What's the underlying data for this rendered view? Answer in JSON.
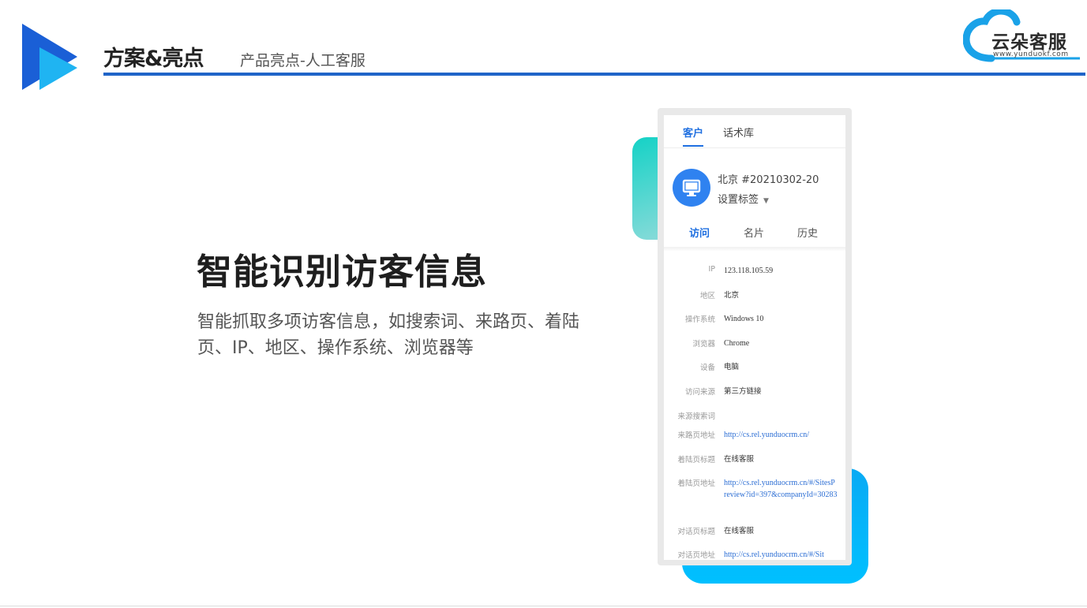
{
  "header": {
    "title": "方案&亮点",
    "subtitle": "产品亮点-人工客服",
    "brand_name": "云朵客服",
    "brand_url": "www.yunduokf.com"
  },
  "main": {
    "headline": "智能识别访客信息",
    "description": "智能抓取多项访客信息，如搜索词、来路页、着陆页、IP、地区、操作系统、浏览器等"
  },
  "panel": {
    "top_tabs": [
      {
        "label": "客户",
        "active": true
      },
      {
        "label": "话术库",
        "active": false
      }
    ],
    "visitor_name": "北京 #20210302-20",
    "tag_setting": "设置标签",
    "sub_tabs": [
      {
        "label": "访问",
        "active": true
      },
      {
        "label": "名片",
        "active": false
      },
      {
        "label": "历史",
        "active": false
      }
    ],
    "rows": [
      {
        "label": "IP",
        "value": "123.118.105.59"
      },
      {
        "label": "地区",
        "value": "北京"
      },
      {
        "label": "操作系统",
        "value": "Windows 10"
      },
      {
        "label": "浏览器",
        "value": "Chrome"
      },
      {
        "label": "设备",
        "value": "电脑"
      },
      {
        "label": "访问来源",
        "value": "第三方链接"
      },
      {
        "label": "来源搜索词",
        "value": ""
      },
      {
        "label": "来路页地址",
        "value": "http://cs.rel.yunduocrm.cn/"
      },
      {
        "label": "着陆页标题",
        "value": "在线客服"
      },
      {
        "label": "着陆页地址",
        "value": "http://cs.rel.yunduocrm.cn/#/SitesPreview?id=397&companyId=30283"
      },
      {
        "label": "对话页标题",
        "value": "在线客服"
      },
      {
        "label": "对话页地址",
        "value": "http://cs.rel.yunduocrm.cn/#/Sit"
      }
    ]
  },
  "colors": {
    "accent": "#1f64c8",
    "link": "#2c6ed4",
    "teal": "#14d2c6",
    "sky": "#00c0ff"
  }
}
